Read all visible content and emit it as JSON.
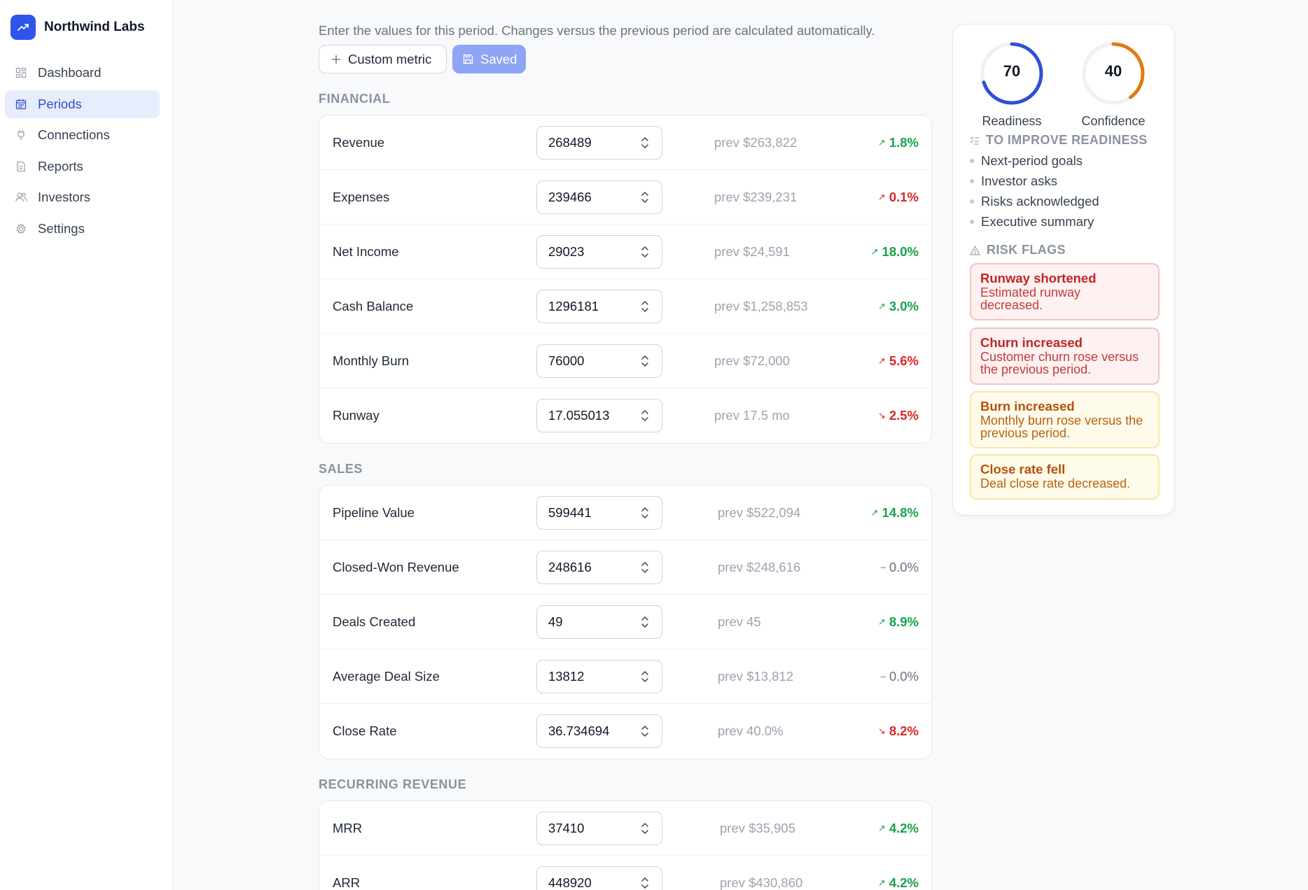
{
  "brand": {
    "name": "Northwind Labs",
    "logo_icon": "trending-up-icon",
    "accent": "#2f54eb"
  },
  "nav": [
    {
      "label": "Dashboard",
      "icon": "grid-icon",
      "active": false
    },
    {
      "label": "Periods",
      "icon": "calendar-icon",
      "active": true
    },
    {
      "label": "Connections",
      "icon": "plug-icon",
      "active": false
    },
    {
      "label": "Reports",
      "icon": "document-icon",
      "active": false
    },
    {
      "label": "Investors",
      "icon": "users-icon",
      "active": false
    },
    {
      "label": "Settings",
      "icon": "gear-icon",
      "active": false
    }
  ],
  "intro": "Enter the values for this period. Changes versus the previous period are calculated automatically.",
  "buttons": {
    "custom_metric": "Custom metric",
    "saved": "Saved"
  },
  "sections": [
    {
      "title": "FINANCIAL",
      "rows": [
        {
          "label": "Revenue",
          "value": "268489",
          "prev": "prev $263,822",
          "change": "1.8%",
          "dir": "up"
        },
        {
          "label": "Expenses",
          "value": "239466",
          "prev": "prev $239,231",
          "change": "0.1%",
          "dir": "up-bad"
        },
        {
          "label": "Net Income",
          "value": "29023",
          "prev": "prev $24,591",
          "change": "18.0%",
          "dir": "up"
        },
        {
          "label": "Cash Balance",
          "value": "1296181",
          "prev": "prev $1,258,853",
          "change": "3.0%",
          "dir": "up"
        },
        {
          "label": "Monthly Burn",
          "value": "76000",
          "prev": "prev $72,000",
          "change": "5.6%",
          "dir": "up-bad"
        },
        {
          "label": "Runway",
          "value": "17.055013",
          "prev": "prev 17.5 mo",
          "change": "2.5%",
          "dir": "down-bad"
        }
      ]
    },
    {
      "title": "SALES",
      "rows": [
        {
          "label": "Pipeline Value",
          "value": "599441",
          "prev": "prev $522,094",
          "change": "14.8%",
          "dir": "up"
        },
        {
          "label": "Closed-Won Revenue",
          "value": "248616",
          "prev": "prev $248,616",
          "change": "0.0%",
          "dir": "flat"
        },
        {
          "label": "Deals Created",
          "value": "49",
          "prev": "prev 45",
          "change": "8.9%",
          "dir": "up"
        },
        {
          "label": "Average Deal Size",
          "value": "13812",
          "prev": "prev $13,812",
          "change": "0.0%",
          "dir": "flat"
        },
        {
          "label": "Close Rate",
          "value": "36.734694",
          "prev": "prev 40.0%",
          "change": "8.2%",
          "dir": "down-bad"
        }
      ]
    },
    {
      "title": "RECURRING REVENUE",
      "rows": [
        {
          "label": "MRR",
          "value": "37410",
          "prev": "prev $35,905",
          "change": "4.2%",
          "dir": "up"
        },
        {
          "label": "ARR",
          "value": "448920",
          "prev": "prev $430,860",
          "change": "4.2%",
          "dir": "up"
        }
      ]
    }
  ],
  "panel": {
    "readiness": {
      "value": 70,
      "label": "Readiness",
      "color": "#2f4fd8"
    },
    "confidence": {
      "value": 40,
      "label": "Confidence",
      "color": "#e07b12"
    },
    "improve_heading": "TO IMPROVE READINESS",
    "improve_items": [
      "Next-period goals",
      "Investor asks",
      "Risks acknowledged",
      "Executive summary"
    ],
    "risk_heading": "RISK FLAGS",
    "flags": [
      {
        "title": "Runway shortened",
        "desc": "Estimated runway decreased.",
        "severity": "red"
      },
      {
        "title": "Churn increased",
        "desc": "Customer churn rose versus the previous period.",
        "severity": "red"
      },
      {
        "title": "Burn increased",
        "desc": "Monthly burn rose versus the previous period.",
        "severity": "yellow"
      },
      {
        "title": "Close rate fell",
        "desc": "Deal close rate decreased.",
        "severity": "yellow"
      }
    ]
  }
}
